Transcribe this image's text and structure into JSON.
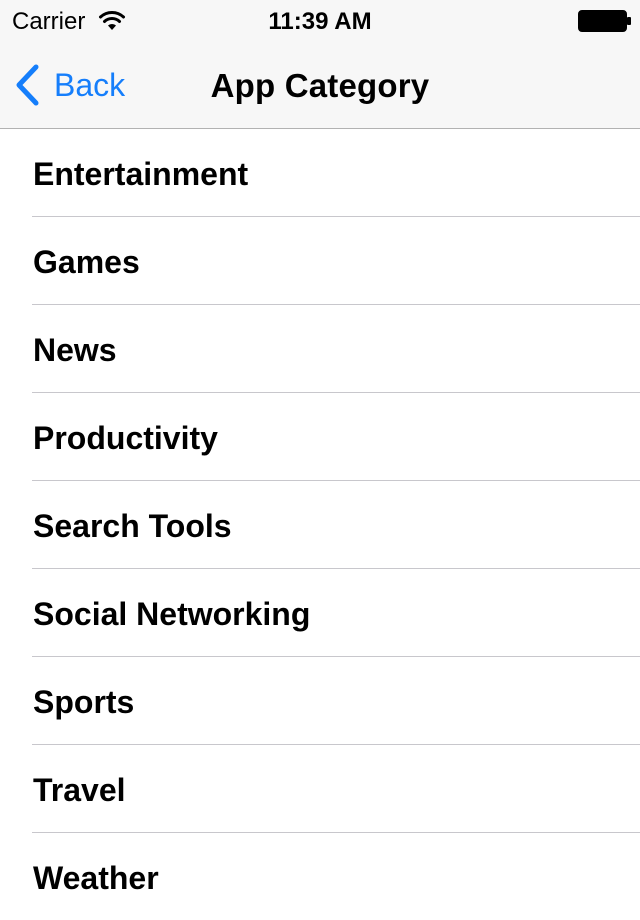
{
  "status_bar": {
    "carrier": "Carrier",
    "time": "11:39 AM",
    "wifi_icon": "wifi-icon",
    "battery_icon": "battery-icon"
  },
  "nav_bar": {
    "back_label": "Back",
    "back_icon": "chevron-left-icon",
    "title": "App Category",
    "tint_color": "#157efb"
  },
  "categories": [
    {
      "label": "Entertainment"
    },
    {
      "label": "Games"
    },
    {
      "label": "News"
    },
    {
      "label": "Productivity"
    },
    {
      "label": "Search Tools"
    },
    {
      "label": "Social Networking"
    },
    {
      "label": "Sports"
    },
    {
      "label": "Travel"
    },
    {
      "label": "Weather"
    }
  ]
}
